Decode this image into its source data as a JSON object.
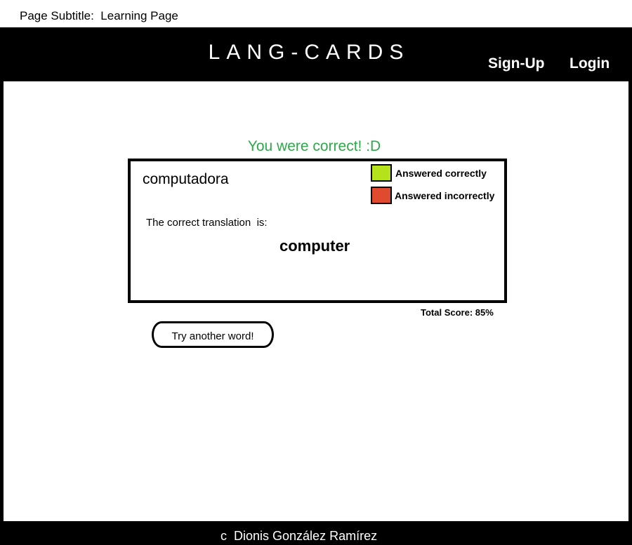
{
  "page_subtitle": "Page Subtitle:  Learning Page",
  "header": {
    "brand": "LANG-CARDS",
    "nav": {
      "signup_label": "Sign-Up",
      "login_label": "Login"
    }
  },
  "main": {
    "feedback": "You were correct! :D",
    "card": {
      "word": "computadora",
      "legend": {
        "correct_label": "Answered correctly",
        "incorrect_label": "Answered incorrectly",
        "correct_color": "#b5e21b",
        "incorrect_color": "#e04a2e"
      },
      "prompt": "The correct translation  is:",
      "translation": "computer"
    },
    "score": "Total Score: 85%",
    "try_button_label": "Try another word!"
  },
  "footer": {
    "copyright": "c  Dionis González Ramírez"
  },
  "colors": {
    "feedback_text": "#2ea84a",
    "frame": "#000000",
    "content_background": "#ffffff"
  }
}
